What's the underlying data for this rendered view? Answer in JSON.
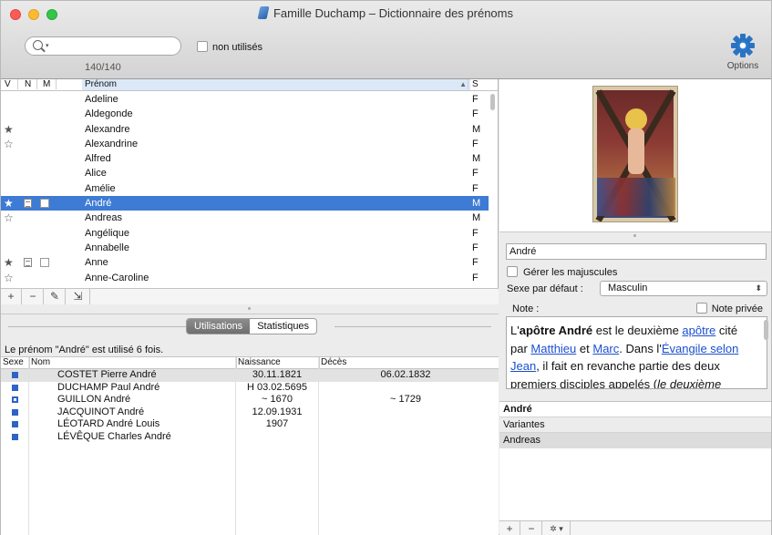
{
  "window": {
    "title": "Famille Duchamp – Dictionnaire des prénoms"
  },
  "toolbar": {
    "search_placeholder": "",
    "unused_label": "non utilisés",
    "count": "140/140",
    "options_label": "Options"
  },
  "names_table": {
    "headers": {
      "v": "V",
      "n": "N",
      "m": "M",
      "prenom": "Prénom",
      "s": "S"
    },
    "rows": [
      {
        "name": "Adeline",
        "sex": "F",
        "star": "",
        "note": false,
        "m": false,
        "selected": false
      },
      {
        "name": "Aldegonde",
        "sex": "F",
        "star": "",
        "note": false,
        "m": false,
        "selected": false
      },
      {
        "name": "Alexandre",
        "sex": "M",
        "star": "★",
        "note": false,
        "m": false,
        "selected": false
      },
      {
        "name": "Alexandrine",
        "sex": "F",
        "star": "☆",
        "note": false,
        "m": false,
        "selected": false
      },
      {
        "name": "Alfred",
        "sex": "M",
        "star": "",
        "note": false,
        "m": false,
        "selected": false
      },
      {
        "name": "Alice",
        "sex": "F",
        "star": "",
        "note": false,
        "m": false,
        "selected": false
      },
      {
        "name": "Amélie",
        "sex": "F",
        "star": "",
        "note": false,
        "m": false,
        "selected": false
      },
      {
        "name": "André",
        "sex": "M",
        "star": "★",
        "note": true,
        "m": true,
        "selected": true
      },
      {
        "name": "Andreas",
        "sex": "M",
        "star": "☆",
        "note": false,
        "m": false,
        "selected": false
      },
      {
        "name": "Angélique",
        "sex": "F",
        "star": "",
        "note": false,
        "m": false,
        "selected": false
      },
      {
        "name": "Annabelle",
        "sex": "F",
        "star": "",
        "note": false,
        "m": false,
        "selected": false
      },
      {
        "name": "Anne",
        "sex": "F",
        "star": "★",
        "note": true,
        "m": true,
        "selected": false
      },
      {
        "name": "Anne-Caroline",
        "sex": "F",
        "star": "☆",
        "note": false,
        "m": false,
        "selected": false
      },
      {
        "name": "Annie",
        "sex": "F",
        "star": "☆",
        "note": false,
        "m": false,
        "selected": false
      }
    ],
    "buttons": [
      "+",
      "−",
      "✎",
      "⇲"
    ]
  },
  "usage": {
    "tabs": [
      "Utilisations",
      "Statistiques"
    ],
    "summary": "Le prénom \"André\" est utilisé 6 fois.",
    "headers": {
      "sexe": "Sexe",
      "nom": "Nom",
      "naissance": "Naissance",
      "deces": "Décès"
    },
    "rows": [
      {
        "sex_icon": "filled",
        "nom": "COSTET Pierre André",
        "naissance": "30.11.1821",
        "deces": "06.02.1832"
      },
      {
        "sex_icon": "filled",
        "nom": "DUCHAMP Paul André",
        "naissance": "H 03.02.5695",
        "deces": ""
      },
      {
        "sex_icon": "hollow",
        "nom": "GUILLON André",
        "naissance": "~ 1670",
        "deces": "~ 1729"
      },
      {
        "sex_icon": "filled",
        "nom": "JACQUINOT André",
        "naissance": "12.09.1931",
        "deces": ""
      },
      {
        "sex_icon": "filled",
        "nom": "LÉOTARD André Louis",
        "naissance": "1907",
        "deces": ""
      },
      {
        "sex_icon": "filled",
        "nom": "LÉVÊQUE Charles André",
        "naissance": "",
        "deces": ""
      }
    ]
  },
  "detail": {
    "name_value": "André",
    "gerer_label": "Gérer les majuscules",
    "sexe_label": "Sexe par défaut :",
    "sexe_value": "Masculin",
    "note_label": "Note :",
    "note_privee_label": "Note privée",
    "note_parts": {
      "p1": "L'",
      "b1": "apôtre André",
      "p2": " est le deuxième ",
      "a1": "apôtre",
      "p3": " cité par ",
      "a2": "Matthieu",
      "p4": " et ",
      "a3": "Marc",
      "p5": ". Dans l'",
      "a4": "Évangile selon Jean",
      "p6": ", il fait en revanche partie des deux premiers disciples appelés (",
      "i1": "le deuxième"
    },
    "variants_title": "André",
    "variants_label": "Variantes",
    "variant_items": [
      "Andreas"
    ],
    "variant_buttons": [
      "+",
      "−",
      "✲ ▾"
    ]
  },
  "colors": {
    "selection": "#3d7bd4",
    "link": "#1b4fd1",
    "sex_blue": "#2e62c6"
  }
}
